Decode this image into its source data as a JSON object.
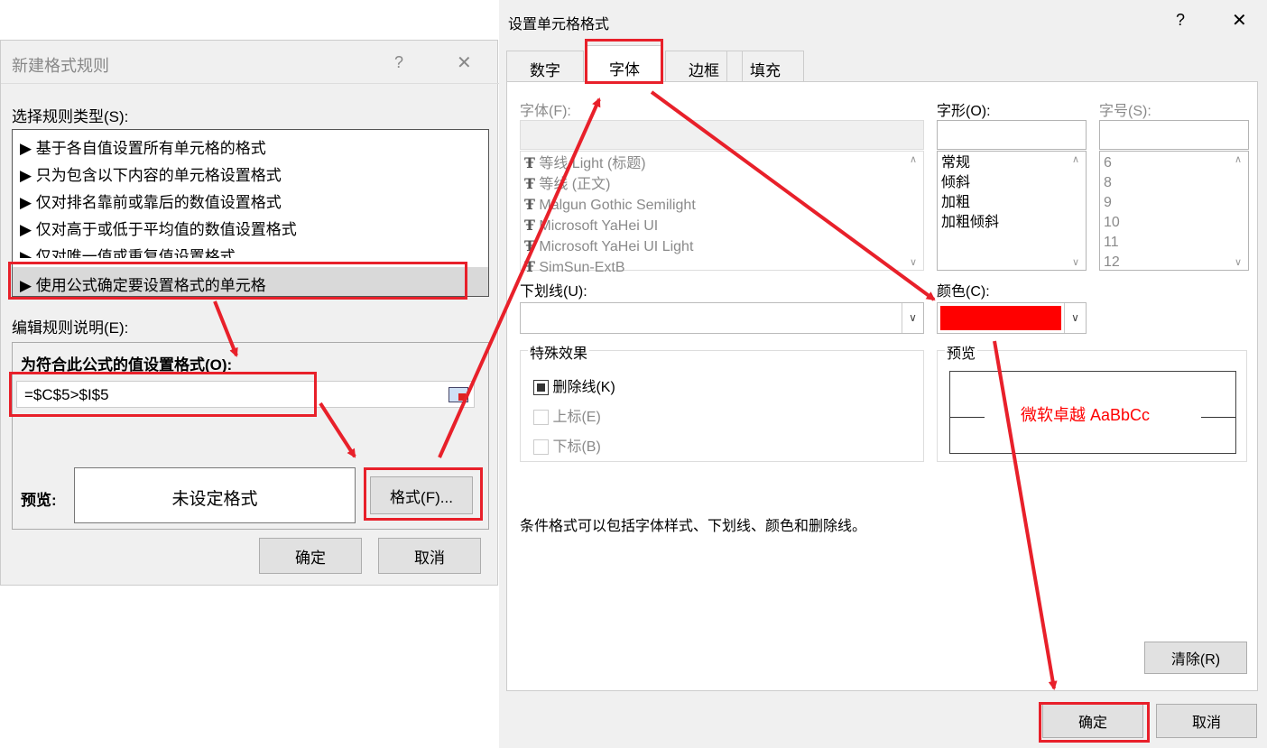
{
  "left_dialog": {
    "title": "新建格式规则",
    "help": "?",
    "close": "✕",
    "rule_type_label": "选择规则类型(S):",
    "rules": [
      "▶ 基于各自值设置所有单元格的格式",
      "▶ 只为包含以下内容的单元格设置格式",
      "▶ 仅对排名靠前或靠后的数值设置格式",
      "▶ 仅对高于或低于平均值的数值设置格式",
      "▶ 仅对唯一值或重复值设置格式",
      "▶ 使用公式确定要设置格式的单元格"
    ],
    "edit_label": "编辑规则说明(E):",
    "formula_label": "为符合此公式的值设置格式(O):",
    "formula_value": "=$C$5>$I$5",
    "preview_label": "预览:",
    "preview_text": "未设定格式",
    "format_button": "格式(F)...",
    "ok": "确定",
    "cancel": "取消"
  },
  "right_dialog": {
    "title": "设置单元格格式",
    "help": "?",
    "close": "✕",
    "tabs": [
      "数字",
      "字体",
      "边框",
      "填充"
    ],
    "font_label": "字体(F):",
    "style_label": "字形(O):",
    "size_label": "字号(S):",
    "fonts": [
      "等线 Light (标题)",
      "等线 (正文)",
      "Malgun Gothic Semilight",
      "Microsoft YaHei UI",
      "Microsoft YaHei UI Light",
      "SimSun-ExtB"
    ],
    "styles": [
      "常规",
      "倾斜",
      "加粗",
      "加粗倾斜"
    ],
    "sizes": [
      "6",
      "8",
      "9",
      "10",
      "11",
      "12"
    ],
    "underline_label": "下划线(U):",
    "color_label": "颜色(C):",
    "color_value": "#ff0000",
    "effects_label": "特殊效果",
    "strikethrough": "删除线(K)",
    "superscript": "上标(E)",
    "subscript": "下标(B)",
    "preview_label": "预览",
    "preview_text": "微软卓越  AaBbCc",
    "note": "条件格式可以包括字体样式、下划线、颜色和删除线。",
    "clear_button": "清除(R)",
    "ok": "确定",
    "cancel": "取消"
  },
  "colors": {
    "annotation_red": "#e8202a",
    "accent_red": "#ff0000"
  }
}
